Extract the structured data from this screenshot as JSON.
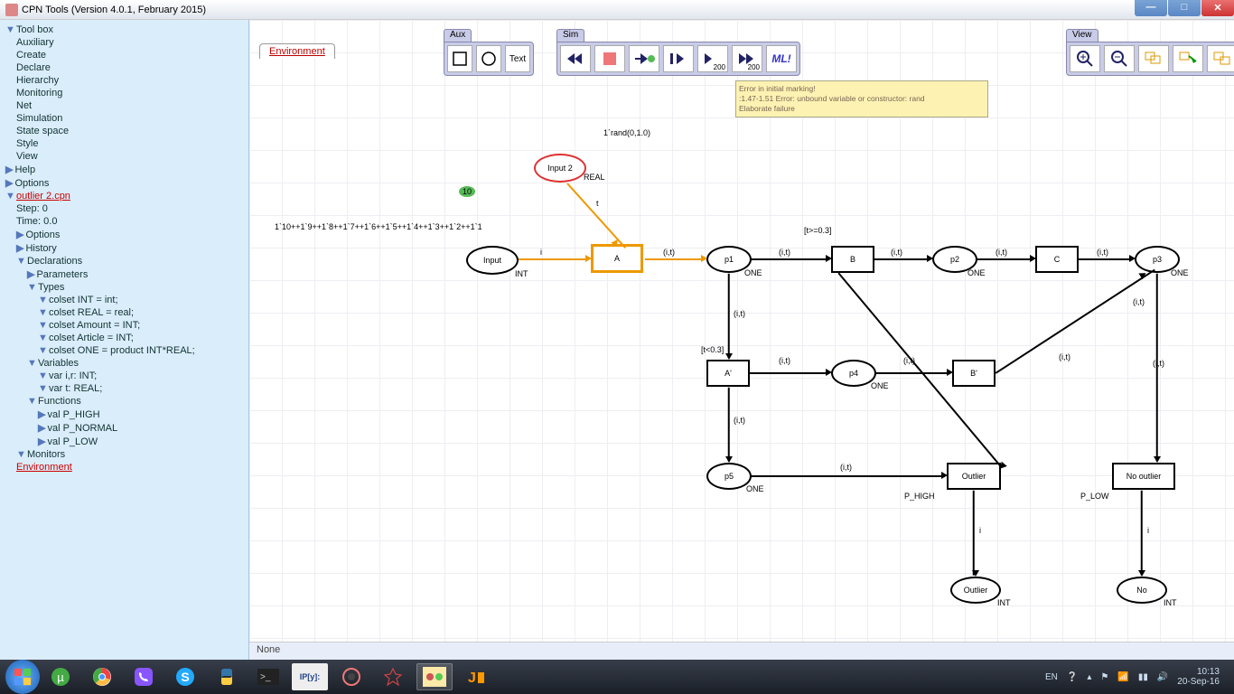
{
  "window": {
    "title": "CPN Tools (Version 4.0.1, February 2015)"
  },
  "sidebar": {
    "toolbox": "Tool box",
    "tb_items": [
      "Auxiliary",
      "Create",
      "Declare",
      "Hierarchy",
      "Monitoring",
      "Net",
      "Simulation",
      "State space",
      "Style",
      "View"
    ],
    "help": "Help",
    "options": "Options",
    "model": "outlier 2.cpn",
    "step": "Step: 0",
    "time": "Time: 0.0",
    "options2": "Options",
    "history": "History",
    "decl": "Declarations",
    "params": "Parameters",
    "types": "Types",
    "type_items": [
      "colset INT = int;",
      "colset REAL = real;",
      "colset Amount = INT;",
      "colset Article = INT;",
      "colset ONE = product INT*REAL;"
    ],
    "vars": "Variables",
    "var_items": [
      "var i,r: INT;",
      "var t: REAL;"
    ],
    "funcs": "Functions",
    "func_items": [
      "val P_HIGH",
      "val P_NORMAL",
      "val P_LOW"
    ],
    "monitors": "Monitors",
    "env": "Environment"
  },
  "env_tab": "Environment",
  "status": "None",
  "error": {
    "l1": "Error in initial marking!",
    "l2": ":1.47-1.51 Error: unbound variable or constructor: rand",
    "l3": "Elaborate failure"
  },
  "toolboxes": {
    "aux": {
      "tab": "Aux",
      "text_btn": "Text"
    },
    "sim": {
      "tab": "Sim",
      "ml": "ML!",
      "n": "200"
    },
    "view": {
      "tab": "View"
    }
  },
  "net": {
    "marking1": "1`rand(0,1.0)",
    "marking2": "1`10++1`9++1`8++1`7++1`6++1`5++1`4++1`3++1`2++1`1",
    "badge10": "10",
    "input": "Input",
    "input_int": "INT",
    "input2": "Input 2",
    "input2_real": "REAL",
    "a": "A",
    "aprime": "A'",
    "b": "B",
    "bprime": "B'",
    "c": "C",
    "p1": "p1",
    "p2": "p2",
    "p3": "p3",
    "p4": "p4",
    "p5": "p5",
    "one": "ONE",
    "int": "INT",
    "outlier_t": "Outlier",
    "nooutlier_t": "No outlier",
    "outlier_p": "Outlier",
    "no_p": "No",
    "phigh": "P_HIGH",
    "plow": "P_LOW",
    "i": "i",
    "t": "t",
    "it": "(i,t)",
    "guard_hi": "[t>=0.3]",
    "guard_lo": "[t<0.3]"
  },
  "task": {
    "lang": "EN",
    "time": "10:13",
    "date": "20-Sep-16",
    "ipy": "IP[y]:"
  }
}
